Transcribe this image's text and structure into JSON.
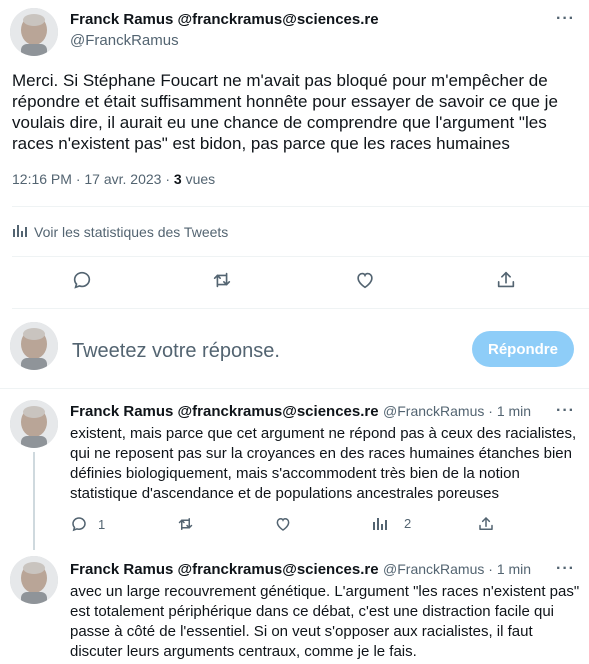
{
  "main_tweet": {
    "author_name": "Franck Ramus @franckramus@sciences.re",
    "author_handle": "@FranckRamus",
    "text_lines": [
      "Merci. Si Stéphane Foucart ne m'avait pas bloqué pour m'empêcher de",
      "répondre et était suffisamment honnête pour essayer de savoir ce que je",
      "voulais dire, il aurait eu une chance de comprendre que l'argument \"les",
      "races n'existent pas\" est bidon, pas parce que les races humaines"
    ],
    "time": "12:16 PM",
    "date": "17 avr. 2023",
    "sep": "·",
    "views_count": "3",
    "views_label": "vues",
    "stats_link": "Voir les statistiques des Tweets",
    "more_label": "···"
  },
  "reply_box": {
    "placeholder": "Tweetez votre réponse.",
    "button_label": "Répondre"
  },
  "thread": [
    {
      "author_name": "Franck Ramus @franckramus@sciences.re",
      "handle_time": "@FranckRamus · 1 min",
      "more_label": "···",
      "lines": [
        "existent, mais parce que cet argument ne répond pas à ceux des racialistes,",
        "qui ne reposent pas sur la croyances en des races humaines étanches bien",
        "définies biologiquement, mais s'accommodent très bien de la notion",
        "statistique d'ascendance et de populations ancestrales poreuses"
      ],
      "reply_count": "1",
      "views_count": "2"
    },
    {
      "author_name": "Franck Ramus @franckramus@sciences.re",
      "handle_time": "@FranckRamus · 1 min",
      "more_label": "···",
      "lines": [
        "avec un large recouvrement génétique. L'argument \"les races n'existent pas\"",
        "est totalement périphérique dans ce débat, c'est une distraction facile qui",
        "passe à côté de l'essentiel. Si on veut s'opposer aux racialistes, il faut",
        "discuter leurs arguments centraux, comme je le fais."
      ]
    }
  ],
  "colors": {
    "text": "#0f1419",
    "muted": "#536471",
    "divider": "#eff3f4",
    "reply_button": "#8ecdf8"
  },
  "icons": [
    "avatar",
    "more-icon",
    "analytics-icon",
    "reply-icon",
    "retweet-icon",
    "like-icon",
    "share-icon"
  ]
}
